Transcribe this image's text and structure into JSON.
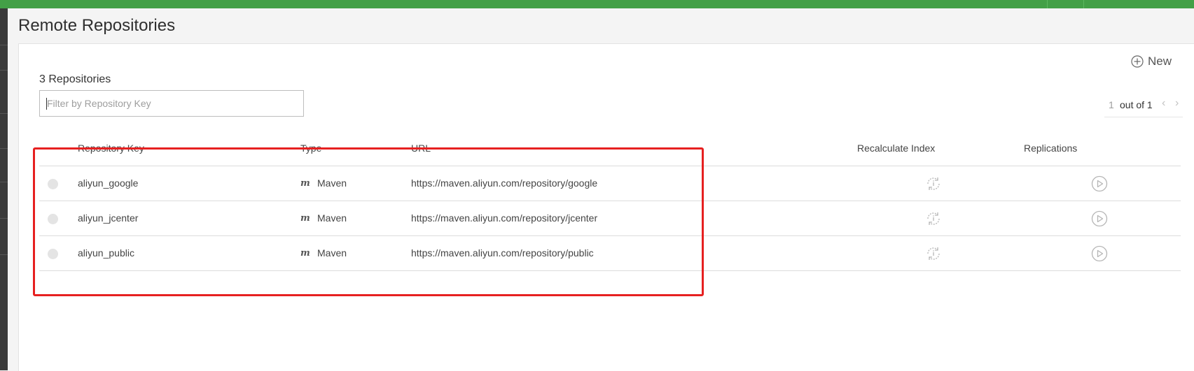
{
  "page": {
    "title": "Remote Repositories"
  },
  "toolbar": {
    "new_label": "New"
  },
  "list": {
    "count_label": "3 Repositories",
    "filter_placeholder": "Filter by Repository Key"
  },
  "pagination": {
    "current": "1",
    "of_label": "out of 1"
  },
  "table": {
    "headers": {
      "key": "Repository Key",
      "type": "Type",
      "url": "URL",
      "recalc": "Recalculate Index",
      "replications": "Replications"
    },
    "rows": [
      {
        "key": "aliyun_google",
        "type_icon": "m",
        "type": "Maven",
        "url": "https://maven.aliyun.com/repository/google"
      },
      {
        "key": "aliyun_jcenter",
        "type_icon": "m",
        "type": "Maven",
        "url": "https://maven.aliyun.com/repository/jcenter"
      },
      {
        "key": "aliyun_public",
        "type_icon": "m",
        "type": "Maven",
        "url": "https://maven.aliyun.com/repository/public"
      }
    ]
  },
  "icons": {
    "new": "plus-circle-icon",
    "recalculate": "refresh-index-icon",
    "replication": "play-circle-icon",
    "prev": "chevron-left-icon",
    "next": "chevron-right-icon"
  },
  "colors": {
    "topbar": "#43a047",
    "highlight": "#e62020",
    "status_dot": "#e4e4e4"
  }
}
